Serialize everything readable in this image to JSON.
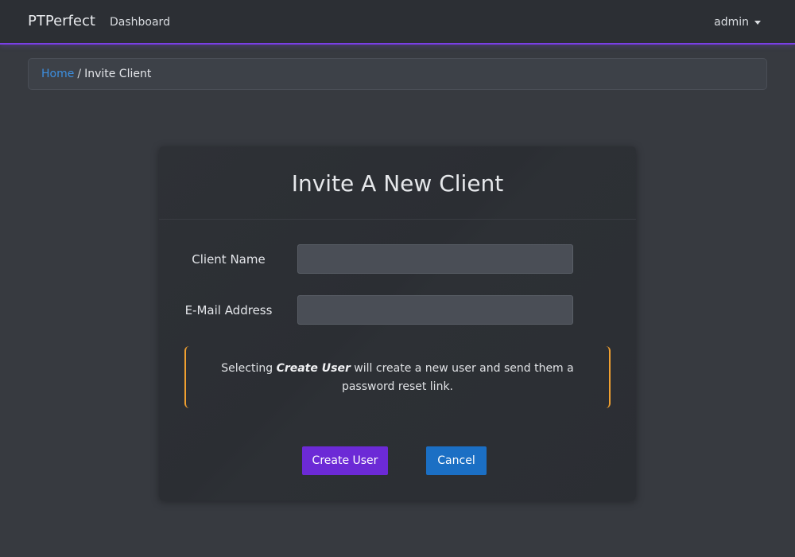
{
  "navbar": {
    "brand": "PTPerfect",
    "links": [
      "Dashboard"
    ],
    "user": "admin"
  },
  "breadcrumb": {
    "home": "Home",
    "separator": "/",
    "current": "Invite Client"
  },
  "card": {
    "title": "Invite A New Client",
    "fields": {
      "client_name": {
        "label": "Client Name",
        "value": "",
        "placeholder": ""
      },
      "email": {
        "label": "E-Mail Address",
        "value": "",
        "placeholder": ""
      }
    },
    "notice": {
      "before": "Selecting ",
      "emphasis": "Create User",
      "after": " will create a new user and send them a password reset link."
    },
    "buttons": {
      "create": "Create User",
      "cancel": "Cancel"
    }
  },
  "colors": {
    "accent": "#6c2ad6",
    "navbar_border": "#7a3fe6",
    "link": "#3d8fe0",
    "cancel": "#1b6fc4",
    "notice_border": "#f0a030"
  }
}
